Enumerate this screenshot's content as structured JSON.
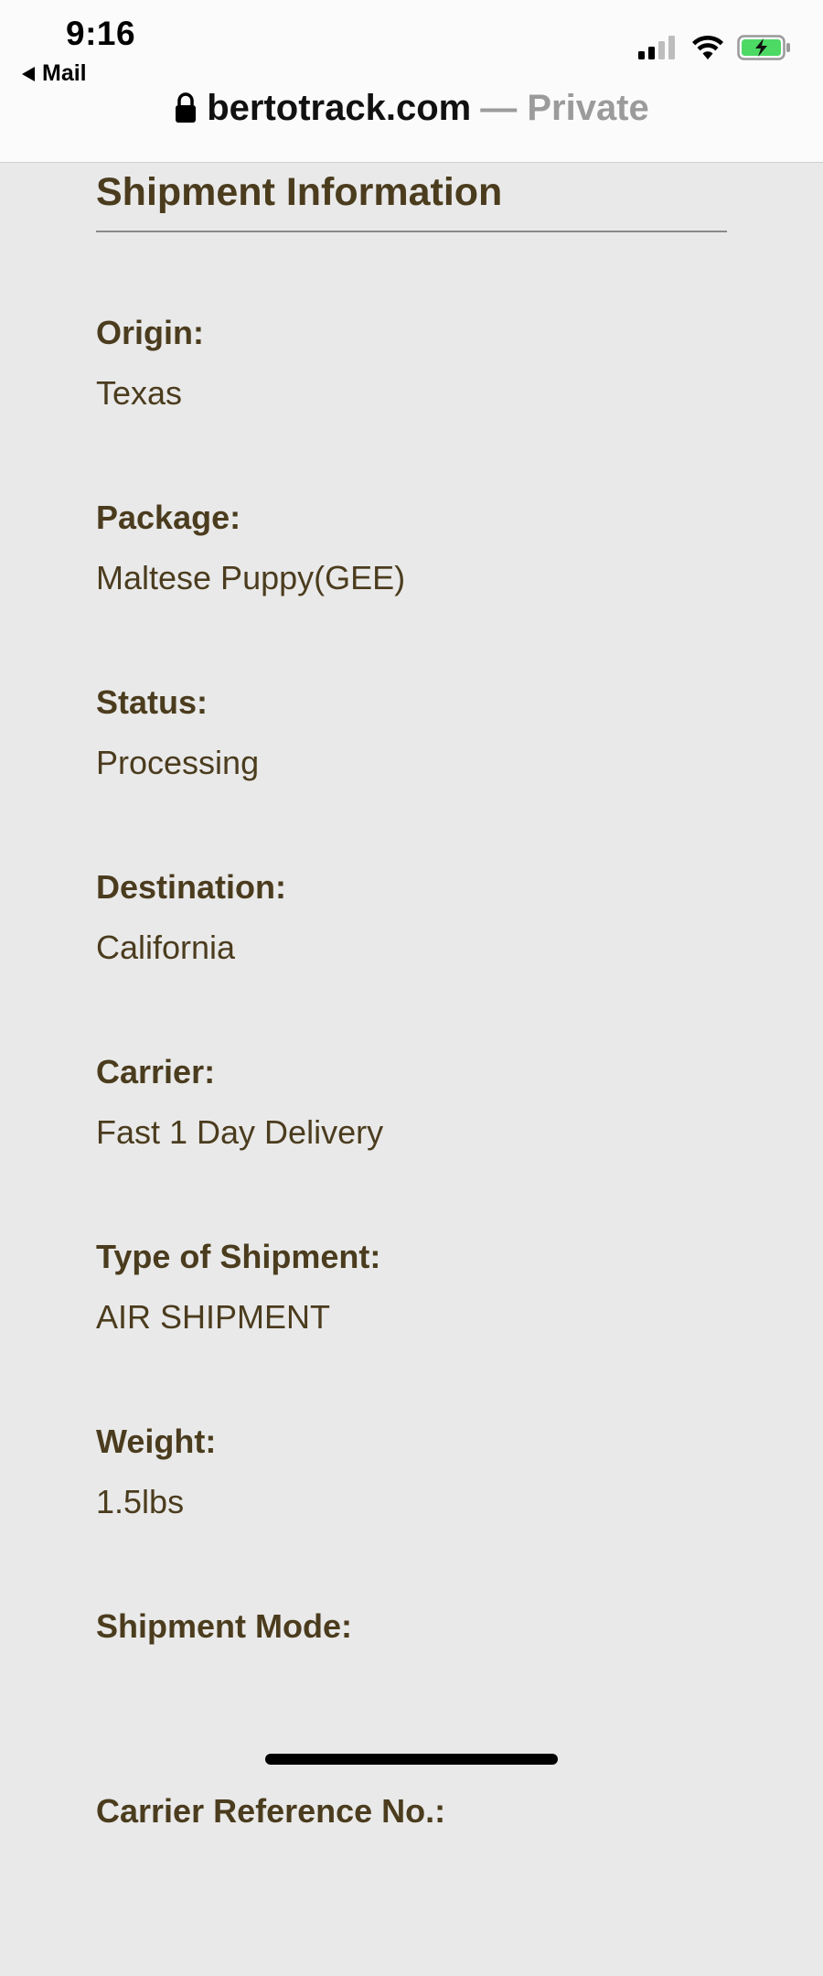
{
  "status_bar": {
    "time": "9:16",
    "back_label": "Mail"
  },
  "browser": {
    "domain": "bertotrack.com",
    "private_label": "— Private"
  },
  "page": {
    "title": "Shipment Information",
    "fields": [
      {
        "label": "Origin:",
        "value": "Texas"
      },
      {
        "label": "Package:",
        "value": "Maltese Puppy(GEE)"
      },
      {
        "label": "Status:",
        "value": "Processing"
      },
      {
        "label": "Destination:",
        "value": "California"
      },
      {
        "label": "Carrier:",
        "value": "Fast 1 Day Delivery"
      },
      {
        "label": "Type of Shipment:",
        "value": "AIR SHIPMENT"
      },
      {
        "label": "Weight:",
        "value": "1.5lbs"
      },
      {
        "label": "Shipment Mode:",
        "value": ""
      },
      {
        "label": "Carrier Reference No.:",
        "value": ""
      }
    ]
  },
  "colors": {
    "text_brown": "#4b3c1e",
    "page_background": "#e9e9e9",
    "battery_green": "#4cd964"
  },
  "icons": [
    "signal-icon",
    "wifi-icon",
    "battery-charging-icon",
    "lock-icon",
    "back-arrow-icon"
  ]
}
